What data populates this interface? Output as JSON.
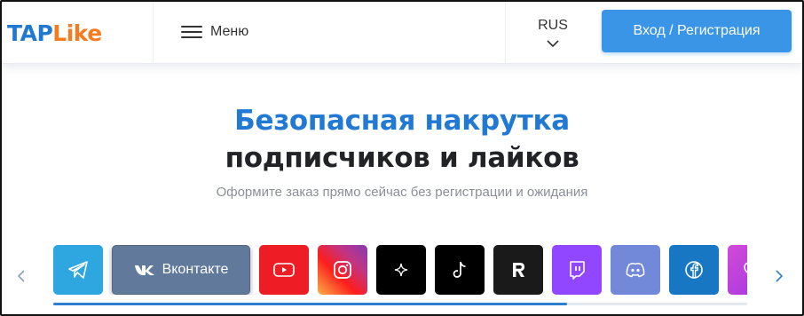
{
  "header": {
    "logo": {
      "part1": "TAP",
      "part2": "Like",
      "color1": "#1f78d1",
      "color2": "#f47b20"
    },
    "menu_label": "Меню",
    "language": "RUS",
    "login_label": "Вход / Регистрация"
  },
  "hero": {
    "title_line1": "Безопасная накрутка",
    "title_line2": "подписчиков и лайков",
    "subtitle": "Оформите заказ прямо сейчас без регистрации и ожидания"
  },
  "carousel": {
    "scroll_progress": 0.74,
    "platforms": [
      {
        "icon": "telegram-icon",
        "color": "#2ea6df",
        "label": ""
      },
      {
        "icon": "vk-icon",
        "color": "#617a9b",
        "label": "Вконтакте",
        "selected": true
      },
      {
        "icon": "youtube-icon",
        "color": "#ee1c24",
        "label": ""
      },
      {
        "icon": "instagram-icon",
        "color": "#d6287a",
        "label": ""
      },
      {
        "icon": "sparkle-icon",
        "color": "#000000",
        "label": ""
      },
      {
        "icon": "tiktok-icon",
        "color": "#000000",
        "label": ""
      },
      {
        "icon": "rutube-icon",
        "color": "#1a1a1a",
        "label": ""
      },
      {
        "icon": "twitch-icon",
        "color": "#9146ff",
        "label": ""
      },
      {
        "icon": "discord-icon",
        "color": "#7289da",
        "label": ""
      },
      {
        "icon": "facebook-icon",
        "color": "#1877c2",
        "label": ""
      },
      {
        "icon": "likee-icon",
        "color": "#b52bd8",
        "label": ""
      }
    ]
  }
}
